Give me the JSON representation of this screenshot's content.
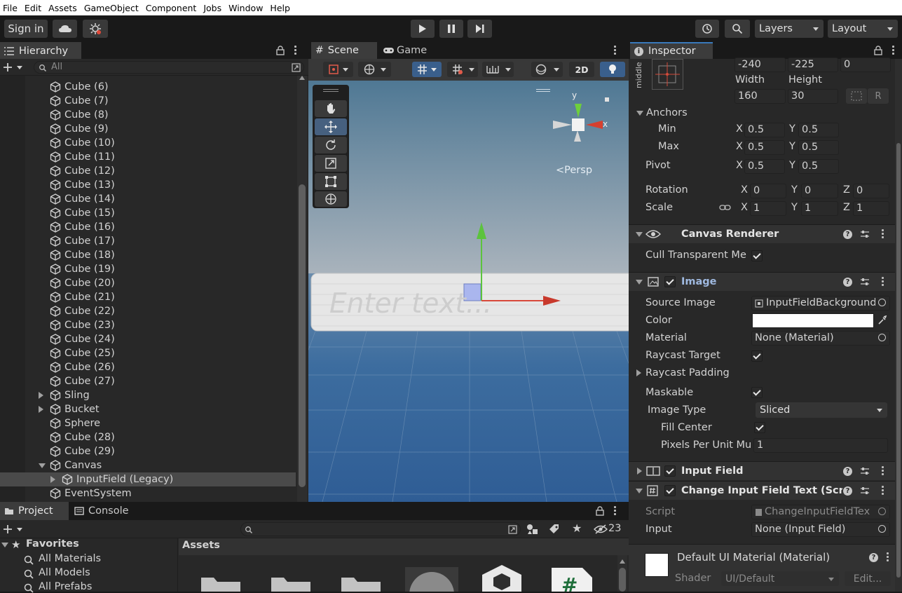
{
  "menu": [
    "File",
    "Edit",
    "Assets",
    "GameObject",
    "Component",
    "Jobs",
    "Window",
    "Help"
  ],
  "toolbar": {
    "sign_in": "Sign in",
    "layers": "Layers",
    "layout": "Layout"
  },
  "hierarchy": {
    "tab": "Hierarchy",
    "search_placeholder": "All",
    "rows": [
      {
        "label": "Cube (6)",
        "indent": 1
      },
      {
        "label": "Cube (7)",
        "indent": 1
      },
      {
        "label": "Cube (8)",
        "indent": 1
      },
      {
        "label": "Cube (9)",
        "indent": 1
      },
      {
        "label": "Cube (10)",
        "indent": 1
      },
      {
        "label": "Cube (11)",
        "indent": 1
      },
      {
        "label": "Cube (12)",
        "indent": 1
      },
      {
        "label": "Cube (13)",
        "indent": 1
      },
      {
        "label": "Cube (14)",
        "indent": 1
      },
      {
        "label": "Cube (15)",
        "indent": 1
      },
      {
        "label": "Cube (16)",
        "indent": 1
      },
      {
        "label": "Cube (17)",
        "indent": 1
      },
      {
        "label": "Cube (18)",
        "indent": 1
      },
      {
        "label": "Cube (19)",
        "indent": 1
      },
      {
        "label": "Cube (20)",
        "indent": 1
      },
      {
        "label": "Cube (21)",
        "indent": 1
      },
      {
        "label": "Cube (22)",
        "indent": 1
      },
      {
        "label": "Cube (23)",
        "indent": 1
      },
      {
        "label": "Cube (24)",
        "indent": 1
      },
      {
        "label": "Cube (25)",
        "indent": 1
      },
      {
        "label": "Cube (26)",
        "indent": 1
      },
      {
        "label": "Cube (27)",
        "indent": 1
      },
      {
        "label": "Sling",
        "indent": 1,
        "fold": "closed"
      },
      {
        "label": "Bucket",
        "indent": 1,
        "fold": "closed"
      },
      {
        "label": "Sphere",
        "indent": 1
      },
      {
        "label": "Cube (28)",
        "indent": 1
      },
      {
        "label": "Cube (29)",
        "indent": 1
      },
      {
        "label": "Canvas",
        "indent": 1,
        "fold": "open"
      },
      {
        "label": "InputField (Legacy)",
        "indent": 2,
        "fold": "closed",
        "selected": true
      },
      {
        "label": "EventSystem",
        "indent": 1
      }
    ]
  },
  "scene": {
    "tab_scene": "Scene",
    "tab_game": "Game",
    "btn_2d": "2D",
    "gizmo_y": "y",
    "gizmo_x": "x",
    "persp": "Persp",
    "input_placeholder": "Enter text..."
  },
  "inspector": {
    "tab": "Inspector",
    "pos": {
      "x": "-240",
      "y": "-225",
      "z": "0"
    },
    "middle": "middle",
    "width_label": "Width",
    "height_label": "Height",
    "width": "160",
    "height": "30",
    "r_btn": "R",
    "anchors": "Anchors",
    "min": "Min",
    "max": "Max",
    "pivot": "Pivot",
    "rotation": "Rotation",
    "scale": "Scale",
    "x": "X",
    "y": "Y",
    "z": "Z",
    "anchor_min": {
      "x": "0.5",
      "y": "0.5"
    },
    "anchor_max": {
      "x": "0.5",
      "y": "0.5"
    },
    "pivot_v": {
      "x": "0.5",
      "y": "0.5"
    },
    "rot": {
      "x": "0",
      "y": "0",
      "z": "0"
    },
    "scl": {
      "x": "1",
      "y": "1",
      "z": "1"
    },
    "canvas_renderer": "Canvas Renderer",
    "cull": "Cull Transparent Me",
    "image": "Image",
    "source_image_label": "Source Image",
    "source_image": "InputFieldBackground",
    "color": "Color",
    "material_label": "Material",
    "material": "None (Material)",
    "raycast_target": "Raycast Target",
    "raycast_padding": "Raycast Padding",
    "maskable": "Maskable",
    "image_type_label": "Image Type",
    "image_type": "Sliced",
    "fill_center": "Fill Center",
    "ppu_label": "Pixels Per Unit Mu",
    "ppu": "1",
    "input_field": "Input Field",
    "change_script": "Change Input Field Text (Scrip",
    "script_label": "Script",
    "script": "ChangeInputFieldTex",
    "input_label": "Input",
    "input_value": "None (Input Field)",
    "default_mat": "Default UI Material (Material)",
    "shader_label": "Shader",
    "shader": "UI/Default",
    "edit": "Edit..."
  },
  "project": {
    "tab_project": "Project",
    "tab_console": "Console",
    "favorites": "Favorites",
    "fav_items": [
      "All Materials",
      "All Models",
      "All Prefabs"
    ],
    "assets": "Assets",
    "hidden_count": "23"
  }
}
